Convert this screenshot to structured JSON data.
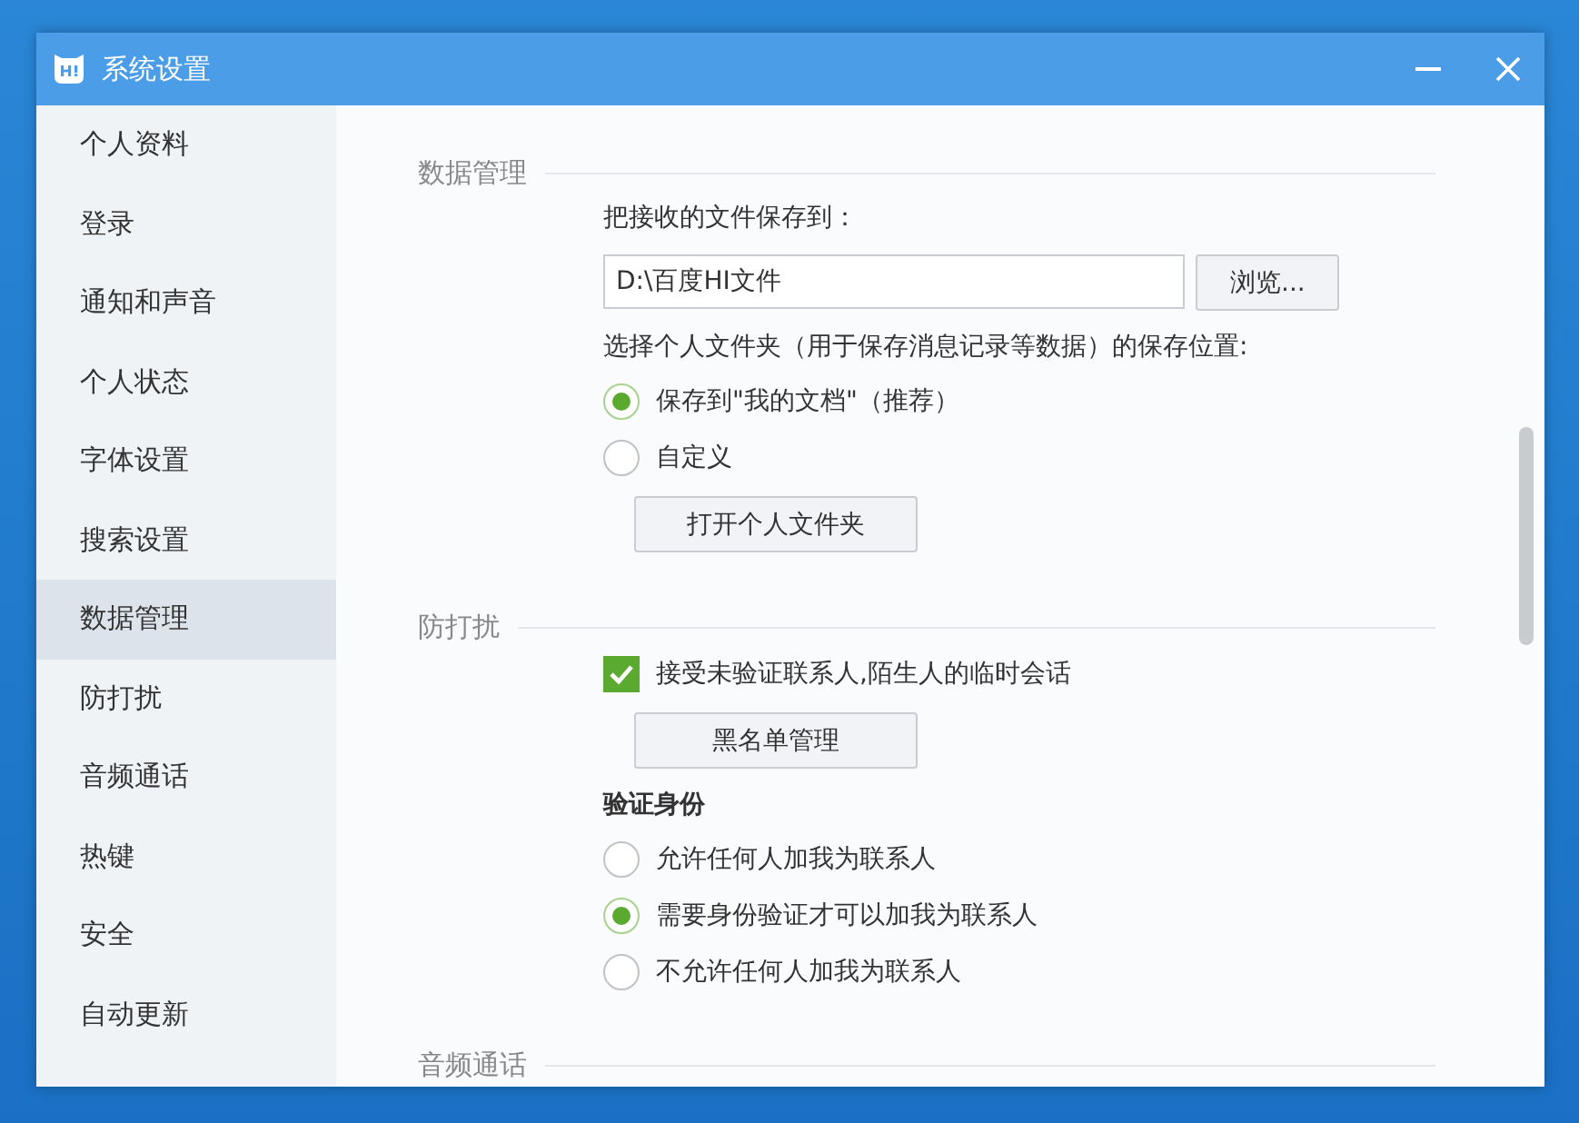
{
  "window": {
    "title": "系统设置"
  },
  "sidebar": {
    "items": [
      {
        "label": "个人资料",
        "selected": false
      },
      {
        "label": "登录",
        "selected": false
      },
      {
        "label": "通知和声音",
        "selected": false
      },
      {
        "label": "个人状态",
        "selected": false
      },
      {
        "label": "字体设置",
        "selected": false
      },
      {
        "label": "搜索设置",
        "selected": false
      },
      {
        "label": "数据管理",
        "selected": true
      },
      {
        "label": "防打扰",
        "selected": false
      },
      {
        "label": "音频通话",
        "selected": false
      },
      {
        "label": "热键",
        "selected": false
      },
      {
        "label": "安全",
        "selected": false
      },
      {
        "label": "自动更新",
        "selected": false
      }
    ]
  },
  "sections": [
    {
      "title": "数据管理",
      "items": [
        {
          "kind": "label",
          "text": "把接收的文件保存到："
        },
        {
          "kind": "path",
          "value": "D:\\百度HI文件",
          "button": "浏览..."
        },
        {
          "kind": "label",
          "text": "选择个人文件夹（用于保存消息记录等数据）的保存位置:"
        },
        {
          "kind": "radio",
          "label": "保存到\"我的文档\"（推荐）",
          "selected": true
        },
        {
          "kind": "radio",
          "label": "自定义",
          "selected": false
        },
        {
          "kind": "button",
          "label": "打开个人文件夹"
        }
      ]
    },
    {
      "title": "防打扰",
      "items": [
        {
          "kind": "checkbox",
          "label": "接受未验证联系人,陌生人的临时会话",
          "checked": true
        },
        {
          "kind": "button",
          "label": "黑名单管理"
        },
        {
          "kind": "subheading",
          "text": "验证身份"
        },
        {
          "kind": "radio",
          "label": "允许任何人加我为联系人",
          "selected": false
        },
        {
          "kind": "radio",
          "label": "需要身份验证才可以加我为联系人",
          "selected": true
        },
        {
          "kind": "radio",
          "label": "不允许任何人加我为联系人",
          "selected": false
        }
      ]
    },
    {
      "title": "音频通话"
    }
  ]
}
